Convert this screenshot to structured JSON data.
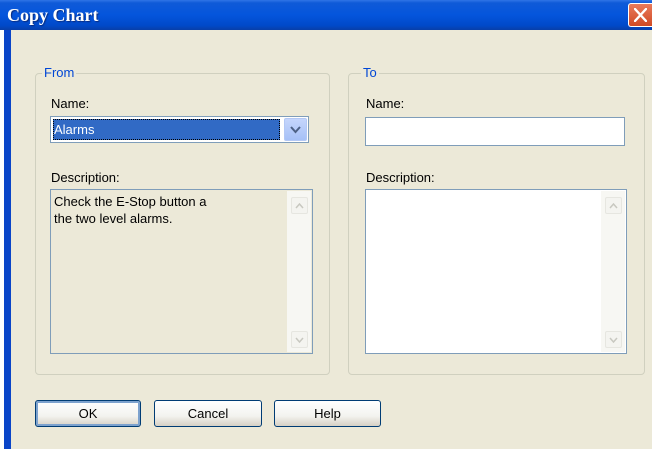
{
  "window": {
    "title": "Copy Chart"
  },
  "from": {
    "group_label": "From",
    "name_label": "Name:",
    "name_value": "Alarms",
    "description_label": "Description:",
    "description_text": "Check the E-Stop button a\nthe two level alarms."
  },
  "to": {
    "group_label": "To",
    "name_label": "Name:",
    "name_value": "",
    "description_label": "Description:",
    "description_text": ""
  },
  "buttons": {
    "ok": "OK",
    "cancel": "Cancel",
    "help": "Help"
  },
  "icons": {
    "close": "close-icon",
    "dropdown": "chevron-down-icon",
    "scroll_up": "scroll-up-arrow-icon",
    "scroll_down": "scroll-down-arrow-icon"
  },
  "colors": {
    "titlebar": "#0455dc",
    "dialog_background": "#ece9d8",
    "selection": "#316ac5",
    "group_label": "#0046d5"
  }
}
